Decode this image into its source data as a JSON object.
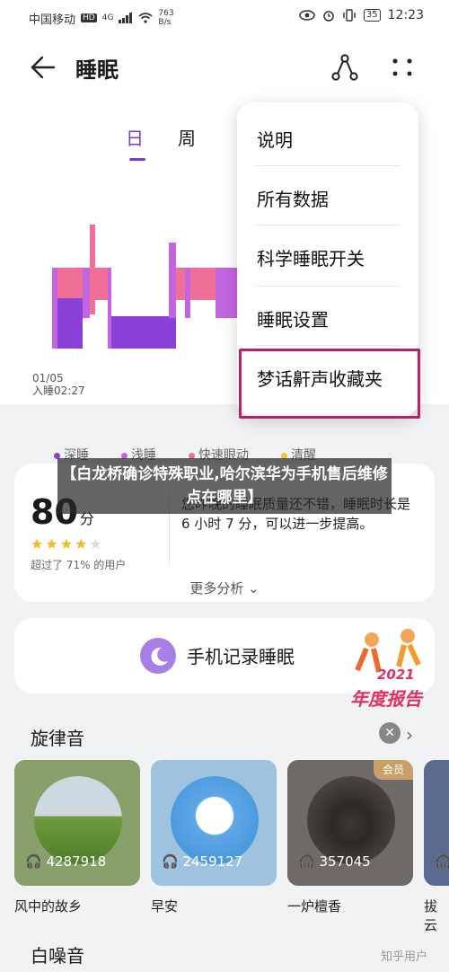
{
  "status_bar": {
    "carrier": "中国移动",
    "hd": "HD",
    "network": "4G",
    "speed_value": "763",
    "speed_unit": "B/s",
    "battery": "35",
    "time": "12:23"
  },
  "header": {
    "title": "睡眠"
  },
  "tabs": [
    {
      "label": "日"
    },
    {
      "label": "周"
    }
  ],
  "chart": {
    "date": "01/05",
    "sleep_time": "入睡02:27"
  },
  "legend": [
    {
      "label": "深睡",
      "color": "#8a3fd6"
    },
    {
      "label": "浅睡",
      "color": "#c364e0"
    },
    {
      "label": "快速眼动",
      "color": "#f06f96"
    },
    {
      "label": "清醒",
      "color": "#f5c13b"
    }
  ],
  "score_card": {
    "score": "80",
    "unit": "分",
    "stars_filled": 4,
    "stars_total": 5,
    "beat": "超过了 71% 的用户",
    "description": "您昨晚的睡眠质量还不错，睡眠时长是6 小时 7 分，可以进一步提高。",
    "more": "更多分析"
  },
  "record": {
    "label": "手机记录睡眠"
  },
  "promo": {
    "year": "2021",
    "label": "年度报告"
  },
  "sections": {
    "melody": "旋律音",
    "white_noise": "白噪音"
  },
  "tiles": [
    {
      "name": "风中的故乡",
      "count": "4287918",
      "vip": false
    },
    {
      "name": "早安",
      "count": "2459127",
      "vip": false
    },
    {
      "name": "一炉檀香",
      "count": "357045",
      "vip": true,
      "badge": "会员"
    },
    {
      "name": "拔云",
      "count": "",
      "vip": false
    }
  ],
  "menu": {
    "items": [
      {
        "label": "说明"
      },
      {
        "label": "所有数据"
      },
      {
        "label": "科学睡眠开关"
      },
      {
        "label": "睡眠设置"
      },
      {
        "label": "梦话鼾声收藏夹"
      }
    ]
  },
  "overlay": {
    "text": "【白龙桥确诊特殊职业,哈尔滨华为手机售后维修点在哪里】"
  },
  "watermark": "知乎用户"
}
